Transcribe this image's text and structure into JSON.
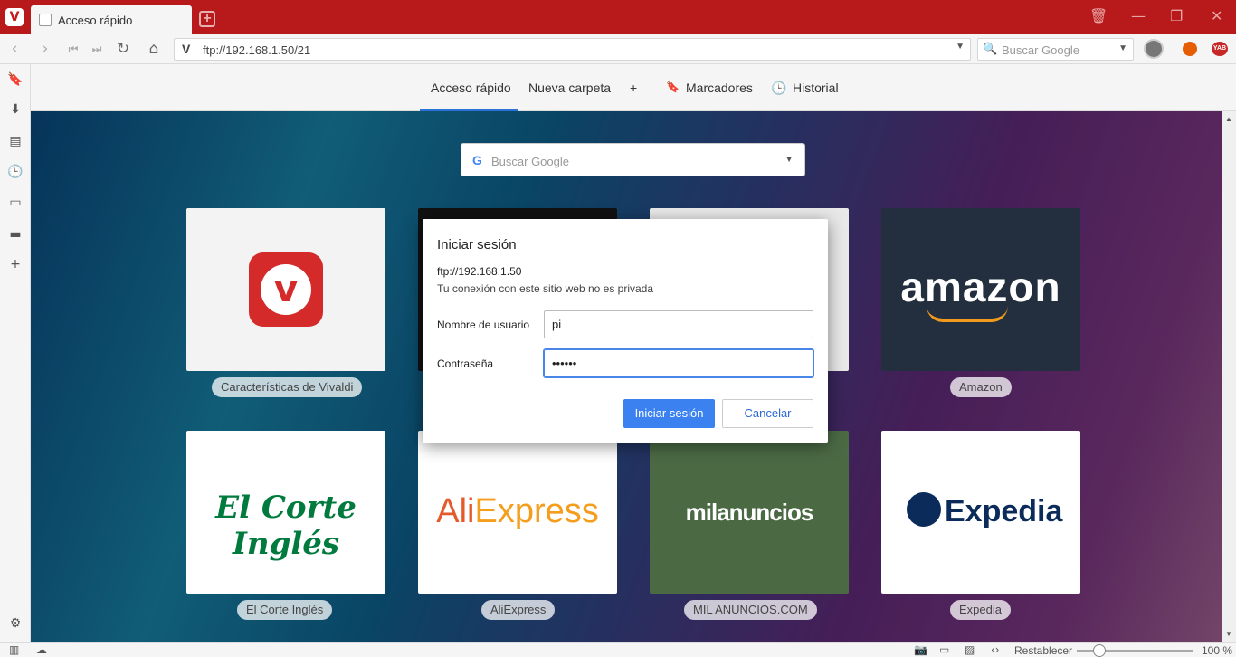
{
  "tabbar": {
    "tab_title": "Acceso rápido"
  },
  "addressbar": {
    "url": "ftp://192.168.1.50/21",
    "search_placeholder": "Buscar Google",
    "ext2_label": "YAB"
  },
  "speed_dial": {
    "tabs": [
      "Acceso rápido",
      "Nueva carpeta",
      "+",
      "Marcadores",
      "Historial"
    ]
  },
  "content": {
    "search_placeholder": "Buscar Google",
    "tiles": [
      {
        "label": "Características de Vivaldi",
        "logo": "vivaldi-logo"
      },
      {
        "label": "Amazon",
        "logo_text": "amazon"
      },
      {
        "label": "El Corte Inglés",
        "logo_text": "El Corte Inglés"
      },
      {
        "label": "AliExpress",
        "logo_text_a": "Ali",
        "logo_text_b": "Express"
      },
      {
        "label": "MIL ANUNCIOS.COM",
        "logo_text": "milanuncios"
      },
      {
        "label": "Expedia",
        "logo_text": "Expedia"
      }
    ]
  },
  "dialog": {
    "title": "Iniciar sesión",
    "host": "ftp://192.168.1.50",
    "note": "Tu conexión con este sitio web no es privada",
    "username_label": "Nombre de usuario",
    "username_value": "pi",
    "password_label": "Contraseña",
    "password_value": "••••••",
    "submit_label": "Iniciar sesión",
    "cancel_label": "Cancelar"
  },
  "statusbar": {
    "reset_label": "Restablecer",
    "zoom": "100 %"
  },
  "colors": {
    "tabbar": "#b8191b",
    "accent": "#3b82f0"
  }
}
